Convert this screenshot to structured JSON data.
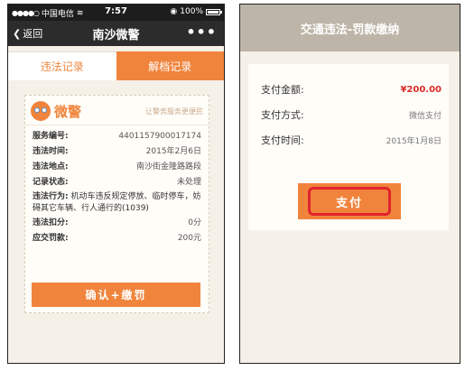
{
  "left_screen": {
    "statusbar": {
      "carrier": "中国电信",
      "time": "7:57",
      "battery_text": "100%",
      "battery_level": 1.0
    },
    "navbar": {
      "back_label": "返回",
      "title": "南沙微警",
      "more_label": "•••"
    },
    "tabs": [
      {
        "label": "违法记录",
        "active": true
      },
      {
        "label": "解档记录",
        "active": false
      }
    ],
    "ticket": {
      "logo_text": "微警",
      "slogan": "让警务服务更便民",
      "rows": [
        {
          "label": "服务编号:",
          "value": "4401157900017174"
        },
        {
          "label": "违法时间:",
          "value": "2015年2月6日"
        },
        {
          "label": "违法地点:",
          "value": "南沙街金隆路路段"
        },
        {
          "label": "记录状态:",
          "value": "未处理"
        }
      ],
      "behavior_label": "违法行为:",
      "behavior_text": "机动车违反规定停放、临时停车，妨碍其它车辆、行人通行的(1039)",
      "rows2": [
        {
          "label": "违法扣分:",
          "value": "0分"
        },
        {
          "label": "应交罚款:",
          "value": "200元"
        }
      ]
    },
    "confirm_button": "确认+缴罚"
  },
  "right_screen": {
    "header_title": "交通违法-罚款缴纳",
    "rows": [
      {
        "label": "支付金额:",
        "value": "¥200.00"
      },
      {
        "label": "支付方式:",
        "value": "微信支付"
      },
      {
        "label": "支付时间:",
        "value": "2015年1月8日"
      }
    ],
    "pay_button": "支付"
  },
  "colors": {
    "accent": "#f0843c",
    "highlight_red": "#e0242c",
    "amount_red": "#d92b2b"
  }
}
